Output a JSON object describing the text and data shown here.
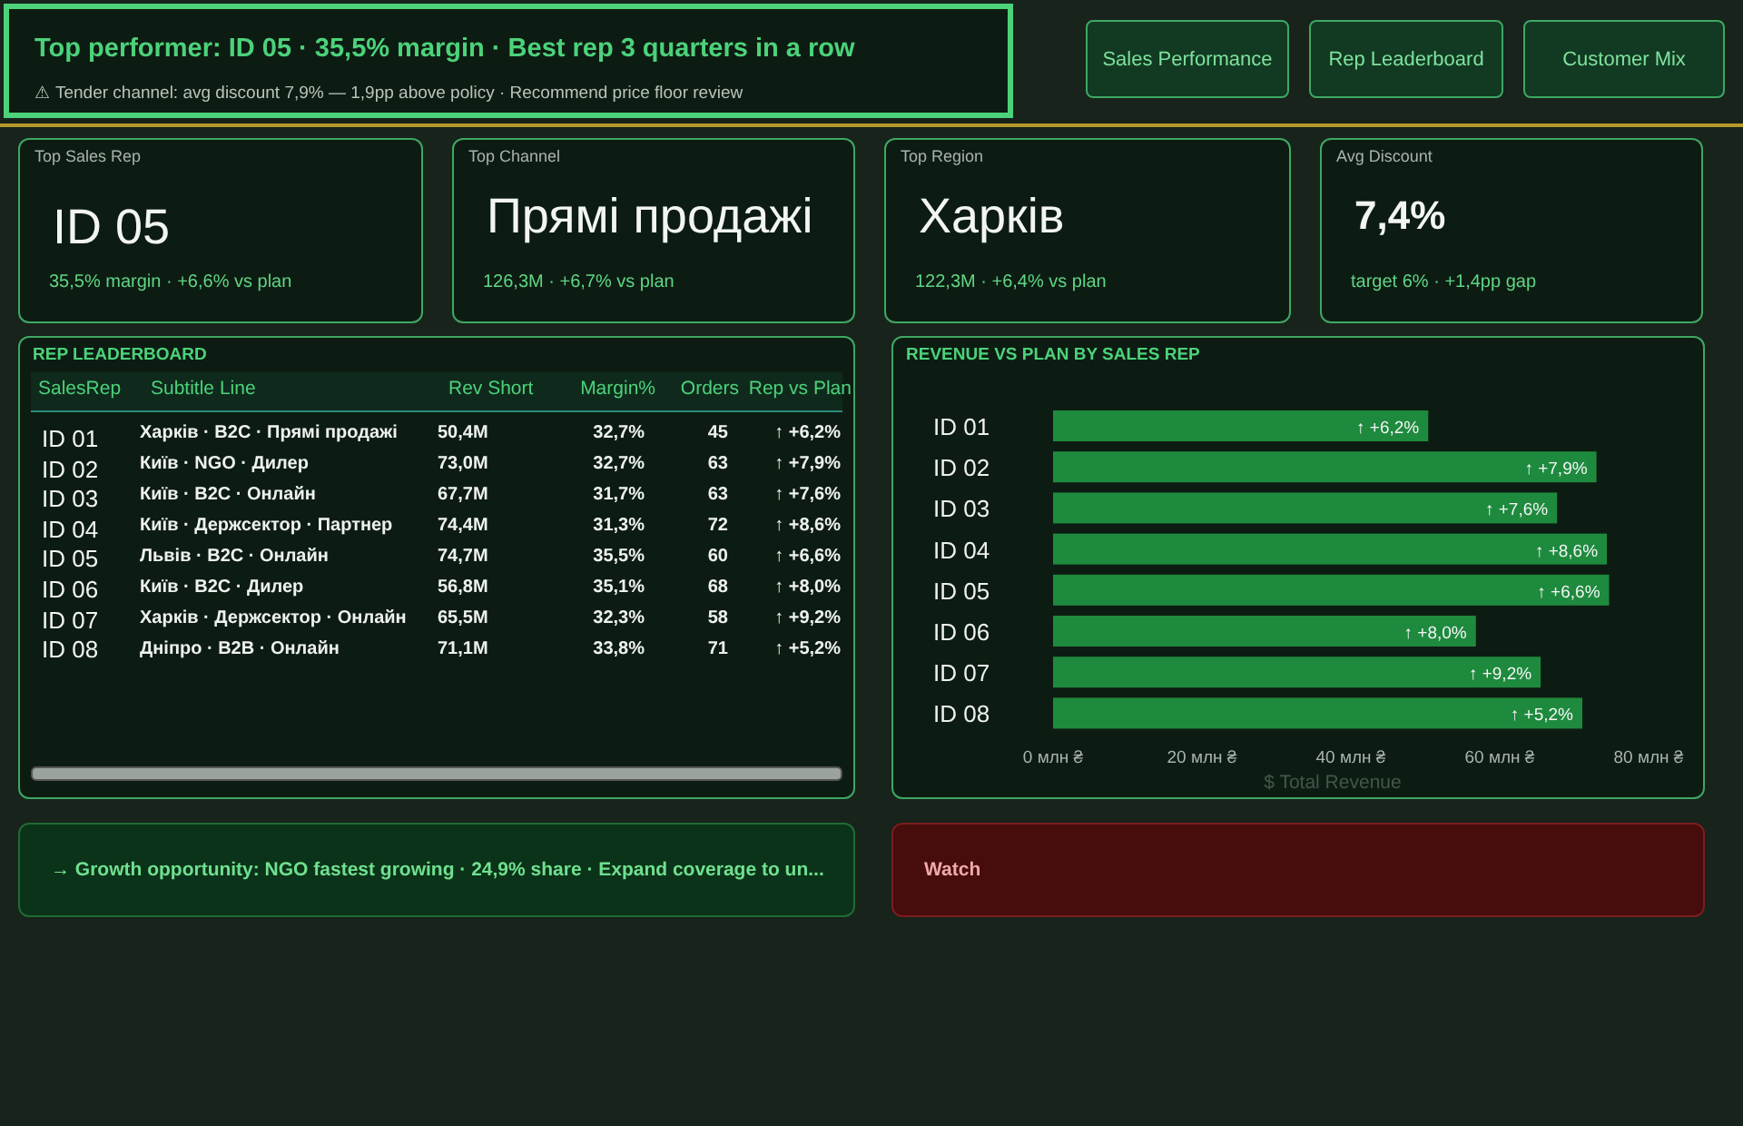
{
  "header": {
    "headline": "Top performer: ID 05 · 35,5% margin · Best rep 3 quarters in a row",
    "alert": "⚠ Tender channel: avg discount 7,9% — 1,9pp above policy · Recommend price floor review"
  },
  "nav_buttons": [
    {
      "label": "Sales Performance",
      "selected": false
    },
    {
      "label": "Rep Leaderboard",
      "selected": false
    },
    {
      "label": "Customer Mix",
      "selected": false
    }
  ],
  "kpis": [
    {
      "title": "Top Sales Rep",
      "value": "ID 05",
      "sub": "35,5% margin · +6,6% vs plan"
    },
    {
      "title": "Top Channel",
      "value": "Прямі продажі",
      "sub": "126,3M · +6,7% vs plan"
    },
    {
      "title": "Top Region",
      "value": "Харків",
      "sub": "122,3M · +6,4% vs plan"
    },
    {
      "title": "Avg Discount",
      "value": "7,4%",
      "sub": "target 6% · +1,4pp gap"
    }
  ],
  "leaderboard": {
    "title": "REP LEADERBOARD",
    "columns": [
      "SalesRep",
      "Subtitle Line",
      "Rev Short",
      "Margin%",
      "Orders",
      "Rep vs Plan"
    ],
    "rows": [
      [
        "ID 01",
        "Харків · B2C · Прямі продажі",
        "50,4M",
        "32,7%",
        "45",
        "↑ +6,2%"
      ],
      [
        "ID 02",
        "Київ · NGO · Дилер",
        "73,0M",
        "32,7%",
        "63",
        "↑ +7,9%"
      ],
      [
        "ID 03",
        "Київ · B2C · Онлайн",
        "67,7M",
        "31,7%",
        "63",
        "↑ +7,6%"
      ],
      [
        "ID 04",
        "Київ · Держсектор · Партнер",
        "74,4M",
        "31,3%",
        "72",
        "↑ +8,6%"
      ],
      [
        "ID 05",
        "Львів · B2C · Онлайн",
        "74,7M",
        "35,5%",
        "60",
        "↑ +6,6%"
      ],
      [
        "ID 06",
        "Київ · B2C · Дилер",
        "56,8M",
        "35,1%",
        "68",
        "↑ +8,0%"
      ],
      [
        "ID 07",
        "Харків · Держсектор · Онлайн",
        "65,5M",
        "32,3%",
        "58",
        "↑ +9,2%"
      ],
      [
        "ID 08",
        "Дніпро · B2B · Онлайн",
        "71,1M",
        "33,8%",
        "71",
        "↑ +5,2%"
      ]
    ]
  },
  "revenue_chart": {
    "title": "REVENUE VS PLAN BY SALES REP",
    "chart_data": {
      "type": "bar",
      "orientation": "horizontal",
      "xlabel": "$ Total Revenue",
      "categories": [
        "ID 01",
        "ID 02",
        "ID 03",
        "ID 04",
        "ID 05",
        "ID 06",
        "ID 07",
        "ID 08"
      ],
      "series": [
        {
          "color": "#1e8a3e",
          "values": [
            50.4,
            73.0,
            67.7,
            74.4,
            74.7,
            56.8,
            65.5,
            71.1
          ]
        }
      ],
      "xlim": [
        0,
        80
      ],
      "xticks": [
        {
          "value": 0,
          "label": "0 млн ₴"
        },
        {
          "value": 20,
          "label": "20 млн ₴"
        },
        {
          "value": 40,
          "label": "40 млн ₴"
        },
        {
          "value": 60,
          "label": "60 млн ₴"
        },
        {
          "value": 80,
          "label": "80 млн ₴"
        }
      ],
      "value_labels": [
        "↑ +6,2%",
        "↑ +7,9%",
        "↑ +7,6%",
        "↑ +8,6%",
        "↑ +6,6%",
        "↑ +8,0%",
        "↑ +9,2%",
        "↑ +5,2%"
      ]
    }
  },
  "callouts": [
    {
      "kind": "opportunity",
      "text": "→ Growth opportunity: NGO fastest growing · 24,9% share · Expand coverage to un..."
    },
    {
      "kind": "watch",
      "text": "Watch"
    }
  ]
}
